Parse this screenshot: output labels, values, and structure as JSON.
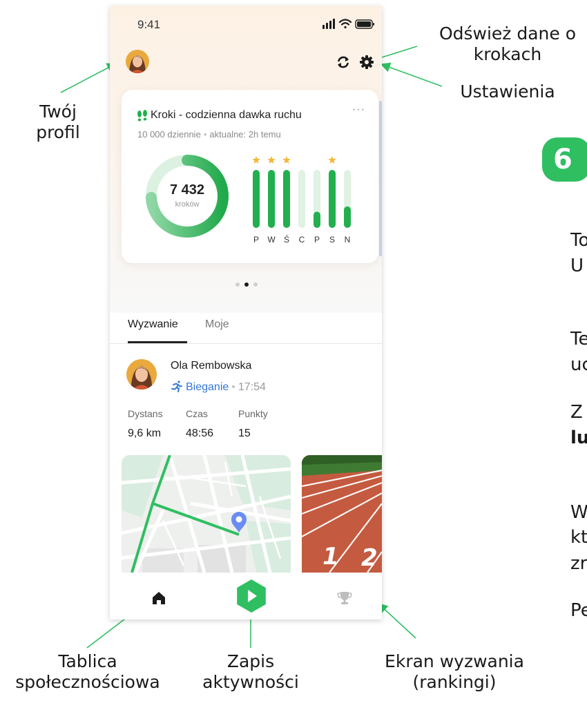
{
  "annotations": {
    "profile": [
      "Twój",
      "profil"
    ],
    "refresh": [
      "Odśwież dane o",
      "krokach"
    ],
    "settings": "Ustawienia",
    "feed": [
      "Tablica",
      "społecznościowa"
    ],
    "record": [
      "Zapis",
      "aktywności"
    ],
    "challenge": [
      "Ekran wyzwania",
      "(rankingi)"
    ]
  },
  "side_panel": {
    "step_badge": "6",
    "peek_lines": [
      "To",
      "U",
      "Te",
      "uc",
      "Z",
      "lu",
      "W",
      "kt",
      "zr",
      "Pe"
    ]
  },
  "status_bar": {
    "time": "9:41"
  },
  "header": {
    "avatar_icon": "profile-avatar",
    "refresh_icon": "refresh-icon",
    "settings_icon": "gear-icon"
  },
  "steps_card": {
    "title": "Kroki - codzienna dawka ruchu",
    "goal": "10 000 dziennie",
    "updated": "aktualne: 2h temu",
    "more": "···",
    "steps_value": "7 432",
    "steps_unit": "kroków",
    "ring_progress": 0.7432,
    "days": [
      {
        "label": "P",
        "progress": 1.0,
        "star": true
      },
      {
        "label": "W",
        "progress": 1.0,
        "star": true
      },
      {
        "label": "Ś",
        "progress": 1.0,
        "star": true
      },
      {
        "label": "C",
        "progress": 0.0,
        "star": false
      },
      {
        "label": "P",
        "progress": 0.28,
        "star": false
      },
      {
        "label": "S",
        "progress": 1.0,
        "star": true
      },
      {
        "label": "N",
        "progress": 0.37,
        "star": false
      }
    ],
    "colors": {
      "green": "#22b04e",
      "light_green": "#dff2e4",
      "star": "#f4b73a"
    }
  },
  "pager": {
    "count": 3,
    "active": 1
  },
  "tabs": [
    {
      "label": "Wyzwanie",
      "active": true
    },
    {
      "label": "Moje",
      "active": false
    }
  ],
  "post": {
    "author": "Ola Rembowska",
    "activity": "Bieganie",
    "time": "17:54",
    "stats": [
      {
        "label": "Dystans",
        "value": "9,6 km"
      },
      {
        "label": "Czas",
        "value": "48:56"
      },
      {
        "label": "Punkty",
        "value": "15"
      }
    ]
  },
  "bottom_nav": [
    {
      "icon": "home-icon",
      "active": true
    },
    {
      "icon": "play-icon",
      "active": false
    },
    {
      "icon": "trophy-icon",
      "active": false
    }
  ],
  "accent_color": "#2fbf61"
}
